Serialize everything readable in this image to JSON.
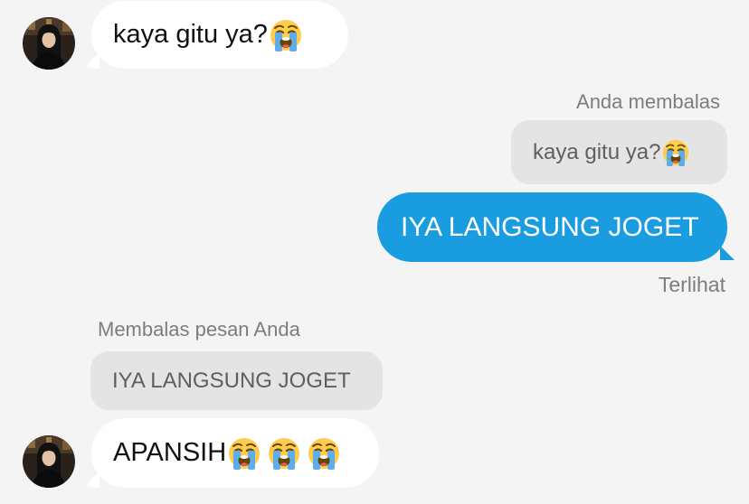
{
  "messages": {
    "incoming_1": {
      "text": "kaya gitu ya?",
      "emoji": "loudly-crying-face-emoji"
    },
    "reply_label": "Anda membalas",
    "reply_quote": {
      "text": "kaya gitu ya?",
      "emoji": "loudly-crying-face-emoji"
    },
    "outgoing_1": {
      "text": "IYA LANGSUNG JOGET"
    },
    "seen_status": "Terlihat",
    "reply_to_you_label": "Membalas pesan Anda",
    "reply_to_you_quote": {
      "text": "IYA LANGSUNG JOGET"
    },
    "incoming_2": {
      "text": "APANSIH",
      "emoji_count": 3,
      "emoji": "loudly-crying-face-emoji"
    }
  },
  "colors": {
    "background": "#f4f4f4",
    "outgoing_bubble": "#1a9de0",
    "incoming_bubble": "#ffffff",
    "quote_bubble": "#e4e4e4",
    "meta_text": "#7d7d7d"
  }
}
